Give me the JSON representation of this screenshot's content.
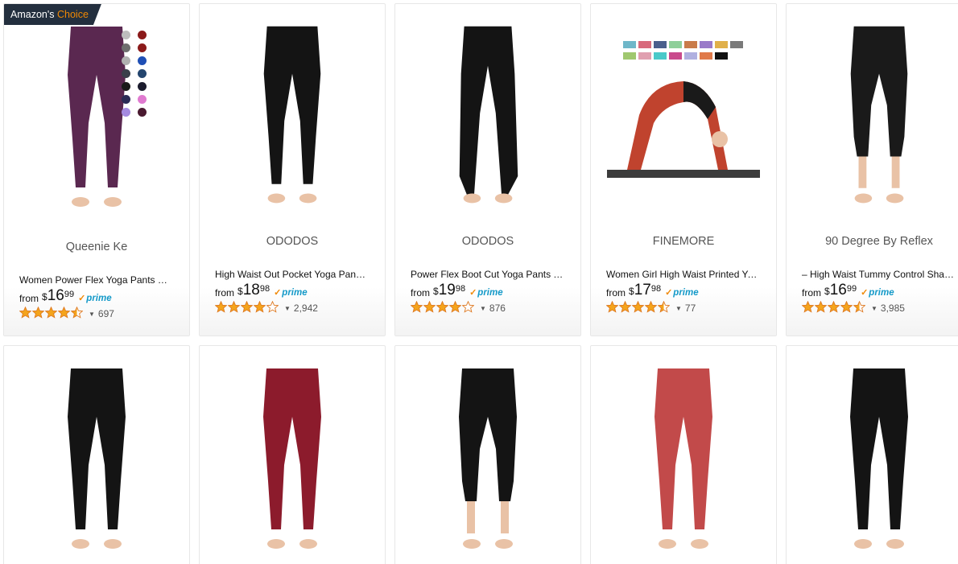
{
  "badge": {
    "prefix": "Amazon's",
    "choice": "Choice"
  },
  "products_row1": [
    {
      "brand": "Queenie Ke",
      "title": "Women Power Flex Yoga Pants Workout Running Leggings",
      "from": "from",
      "dollar": "$",
      "whole": "16",
      "cents": "99",
      "prime": "prime",
      "stars": 4.5,
      "reviews": "697",
      "color": "#5a2850"
    },
    {
      "brand": "ODODOS",
      "title": "High Waist Out Pocket Yoga Pants Tummy Control",
      "from": "from",
      "dollar": "$",
      "whole": "18",
      "cents": "98",
      "prime": "prime",
      "stars": 4.0,
      "reviews": "2,942",
      "color": "#141414"
    },
    {
      "brand": "ODODOS",
      "title": "Power Flex Boot Cut Yoga Pants Tummy Control",
      "from": "from",
      "dollar": "$",
      "whole": "19",
      "cents": "98",
      "prime": "prime",
      "stars": 4.0,
      "reviews": "876",
      "color": "#141414"
    },
    {
      "brand": "FINEMORE",
      "title": "Women Girl High Waist Printed Yoga Pants",
      "from": "from",
      "dollar": "$",
      "whole": "17",
      "cents": "98",
      "prime": "prime",
      "stars": 4.5,
      "reviews": "77",
      "color": "#c0432e"
    },
    {
      "brand": "90 Degree By Reflex",
      "title": "– High Waist Tummy Control Shapewear",
      "from": "from",
      "dollar": "$",
      "whole": "16",
      "cents": "99",
      "prime": "prime",
      "stars": 4.5,
      "reviews": "3,985",
      "color": "#1a1a1a"
    }
  ],
  "products_row2": [
    {
      "color": "#141414"
    },
    {
      "color": "#8c1b2c"
    },
    {
      "color": "#141414"
    },
    {
      "color": "#c24a4a"
    },
    {
      "color": "#141414"
    }
  ],
  "swatch_colors": [
    "#bdbdbd",
    "#8b1a1a",
    "#6e6e6e",
    "#8b1a1a",
    "#b0b0b0",
    "#1f4fb5",
    "#3a3f4a",
    "#24456e",
    "#1a1a1a",
    "#1c1c2e",
    "#2b2b55",
    "#e07ad0",
    "#a58ae0",
    "#4a1a30"
  ],
  "colors": {
    "prime": "#1399c8",
    "star": "#f4a41c",
    "badge_bg": "#232f3e",
    "choice": "#f08804"
  }
}
